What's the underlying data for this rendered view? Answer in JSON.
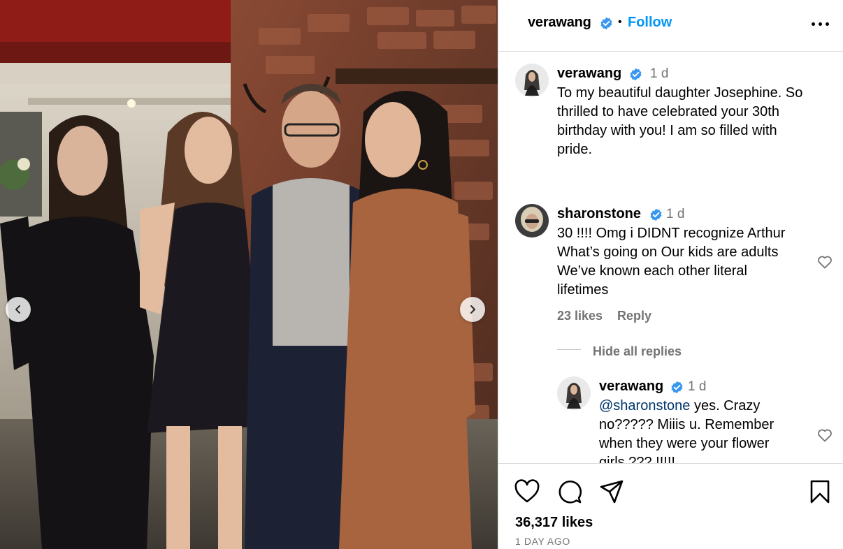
{
  "post": {
    "author": "verawang",
    "follow_label": "Follow",
    "separator": "•"
  },
  "caption": {
    "user": "verawang",
    "time": "1 d",
    "lines": [
      "To my beautiful daughter Josephine. So",
      "thrilled to have celebrated your 30th",
      "birthday with you! I am so filled with",
      "pride."
    ]
  },
  "comment": {
    "user": "sharonstone",
    "time": "1 d",
    "lines": [
      "30 !!!! Omg i DIDNT recognize Arthur",
      "What’s going on Our kids are adults",
      "We’ve known each other literal",
      "lifetimes"
    ],
    "likes": "23 likes",
    "reply_label": "Reply",
    "hide_replies_label": "Hide all replies"
  },
  "reply": {
    "user": "verawang",
    "time": "1 d",
    "mention": "@sharonstone",
    "line1_rest": " yes. Crazy",
    "lines": [
      "no????? Miiis u. Remember",
      "when they were your flower",
      "girls ??? !!!!!"
    ]
  },
  "footer": {
    "likes": "36,317 likes",
    "posted": "1 DAY AGO"
  },
  "icons": {
    "verified": "verified-badge-icon",
    "more": "more-options-icon",
    "like": "heart-icon",
    "comment": "comment-bubble-icon",
    "share": "paper-plane-icon",
    "save": "bookmark-icon",
    "prev": "chevron-left-icon",
    "next": "chevron-right-icon"
  },
  "colors": {
    "link_blue": "#0095f6",
    "verified_blue": "#3897f0",
    "muted_text": "#737373",
    "divider": "#dbdbdb"
  }
}
